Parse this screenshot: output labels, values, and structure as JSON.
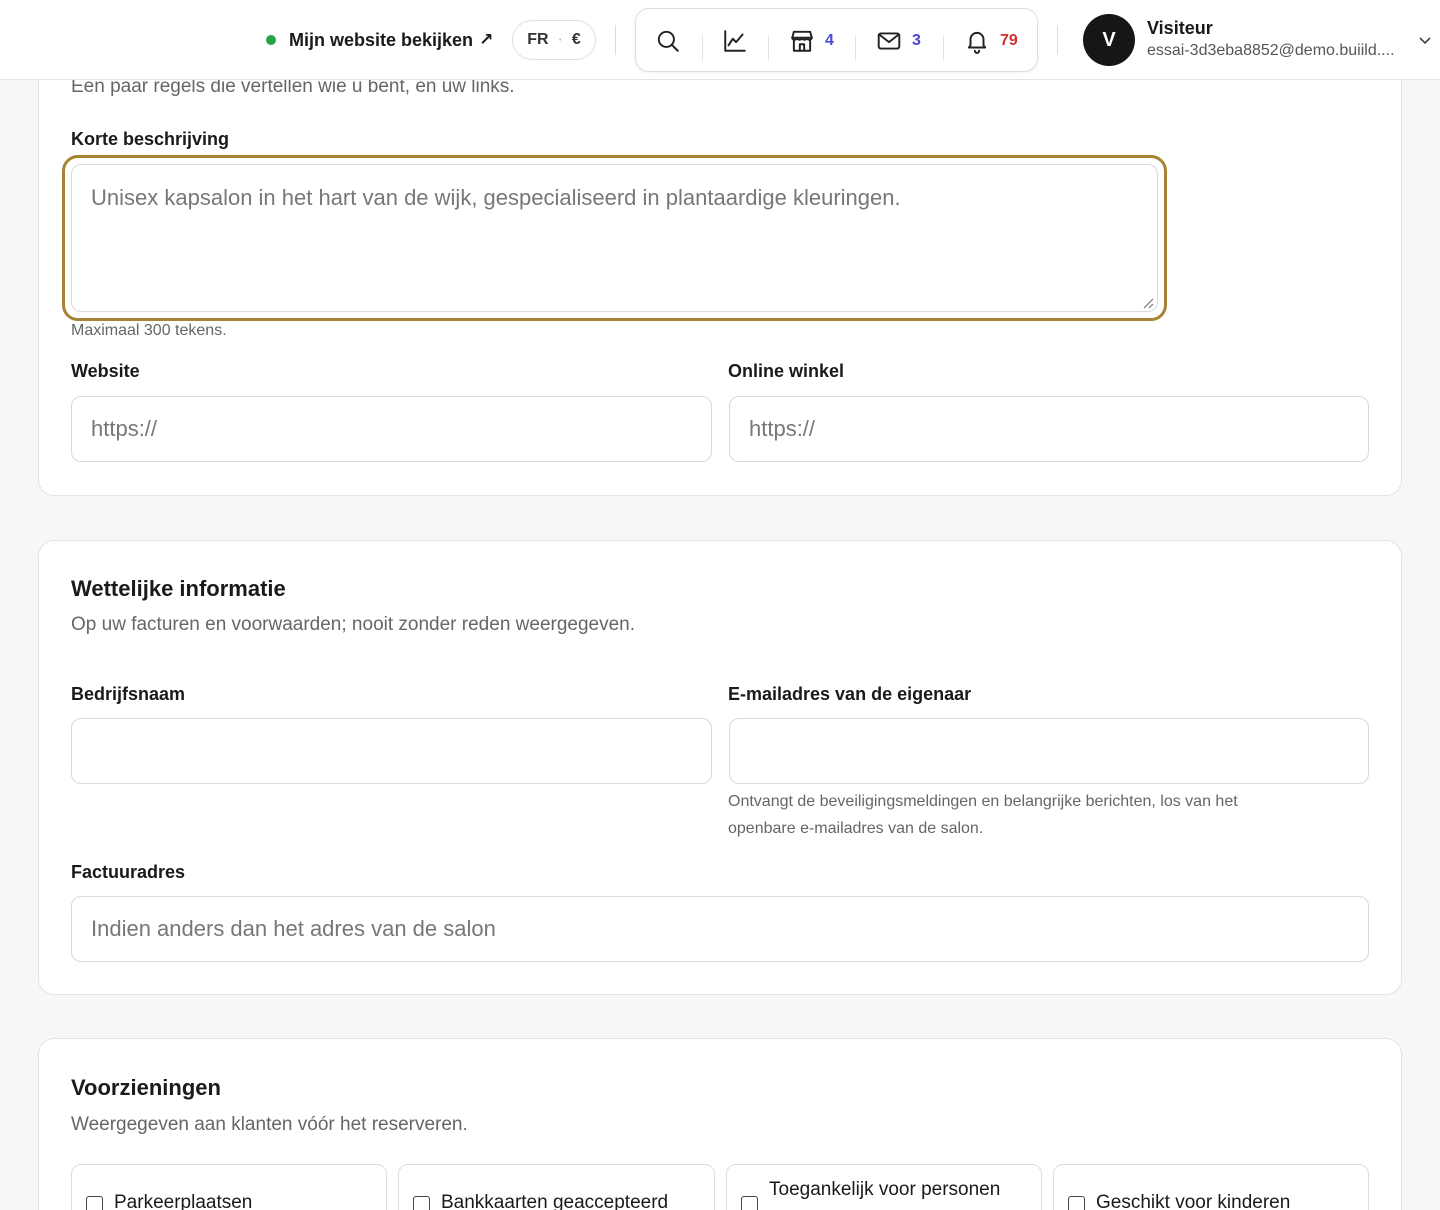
{
  "header": {
    "view_site_label": "Mijn website bekijken",
    "view_site_arrow": "↗",
    "locale_lang": "FR",
    "locale_currency": "€",
    "shop_count": "4",
    "mail_count": "3",
    "notif_count": "79",
    "user": {
      "initial": "V",
      "name": "Visiteur",
      "email": "essai-3d3eba8852@demo.buiild...."
    }
  },
  "colors": {
    "accent_focus": "#a78335",
    "online_dot": "#22a447",
    "count_blue": "#4b47d6",
    "count_red": "#d0312d"
  },
  "profile_section": {
    "subtitle": "Een paar regels die vertellen wie u bent, en uw links.",
    "short_description": {
      "label": "Korte beschrijving",
      "placeholder": "Unisex kapsalon in het hart van de wijk, gespecialiseerd in plantaardige kleuringen.",
      "value": "",
      "help": "Maximaal 300 tekens."
    },
    "website": {
      "label": "Website",
      "placeholder": "https://",
      "value": ""
    },
    "online_shop": {
      "label": "Online winkel",
      "placeholder": "https://",
      "value": ""
    }
  },
  "legal_section": {
    "title": "Wettelijke informatie",
    "subtitle": "Op uw facturen en voorwaarden; nooit zonder reden weergegeven.",
    "company_name": {
      "label": "Bedrijfsnaam",
      "placeholder": "",
      "value": ""
    },
    "owner_email": {
      "label": "E-mailadres van de eigenaar",
      "placeholder": "",
      "value": "",
      "help_line1": "Ontvangt de beveiligingsmeldingen en belangrijke berichten, los van het",
      "help_line2": "openbare e-mailadres van de salon."
    },
    "billing_address": {
      "label": "Factuuradres",
      "placeholder": "Indien anders dan het adres van de salon",
      "value": ""
    }
  },
  "amenities_section": {
    "title": "Voorzieningen",
    "subtitle": "Weergegeven aan klanten vóór het reserveren.",
    "items": [
      {
        "label": "Parkeerplaatsen",
        "checked": false
      },
      {
        "label": "Bankkaarten geaccepteerd",
        "checked": false
      },
      {
        "label": "Toegankelijk voor personen",
        "checked": false
      },
      {
        "label": "Geschikt voor kinderen",
        "checked": false
      }
    ]
  }
}
